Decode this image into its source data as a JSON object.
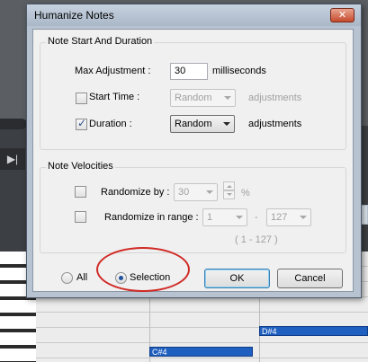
{
  "dialog": {
    "title": "Humanize Notes",
    "close_label": "✕"
  },
  "note_start": {
    "group_label": "Note Start And Duration",
    "max_adjustment_label": "Max Adjustment :",
    "max_adjustment_value": "30",
    "max_adjustment_unit": "milliseconds",
    "start_time_label": "Start Time :",
    "start_time_checked": false,
    "start_time_mode": "Random",
    "start_time_unit": "adjustments",
    "duration_label": "Duration :",
    "duration_checked": true,
    "duration_mode": "Random",
    "duration_unit": "adjustments"
  },
  "velocities": {
    "group_label": "Note Velocities",
    "randomize_by_label": "Randomize by :",
    "randomize_by_value": "30",
    "randomize_by_unit": "%",
    "range_label": "Randomize in range :",
    "range_low": "1",
    "range_dash": "-",
    "range_high": "127",
    "range_hint": "( 1 - 127 )"
  },
  "scope": {
    "all_label": "All",
    "selection_label": "Selection",
    "selected": "Selection"
  },
  "buttons": {
    "ok_label": "OK",
    "cancel_label": "Cancel"
  },
  "background": {
    "play_icon": "▶|",
    "notes": [
      "D#4",
      "C#4"
    ]
  },
  "colors": {
    "annotation_circle": "#d02a25",
    "note_fill": "#1f5fbf",
    "title_bar": "#b8c3d1"
  }
}
